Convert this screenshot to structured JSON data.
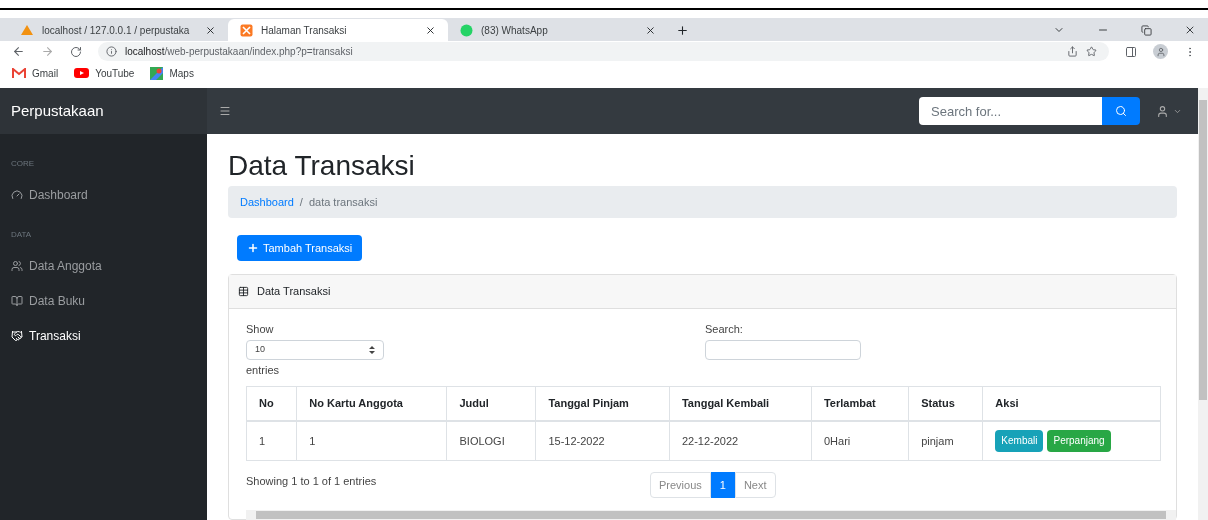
{
  "browser": {
    "tabs": [
      {
        "title": "localhost / 127.0.0.1 / perpustaka",
        "kind": "pma",
        "selected": false
      },
      {
        "title": "Halaman Transaksi",
        "kind": "xampp",
        "selected": true
      },
      {
        "title": "(83) WhatsApp",
        "kind": "whatsapp",
        "selected": false
      }
    ],
    "address": {
      "host": "localhost",
      "path": "/web-perpustakaan/index.php?p=transaksi"
    },
    "bookmarks": [
      {
        "label": "Gmail",
        "kind": "gmail"
      },
      {
        "label": "YouTube",
        "kind": "youtube"
      },
      {
        "label": "Maps",
        "kind": "maps"
      }
    ]
  },
  "navbar": {
    "brand": "Perpustakaan",
    "search": {
      "placeholder": "Search for..."
    }
  },
  "sidebar": {
    "sections": [
      {
        "heading": "CORE",
        "items": [
          {
            "label": "Dashboard",
            "kind": "gauge",
            "selected": false
          }
        ]
      },
      {
        "heading": "DATA",
        "items": [
          {
            "label": "Data Anggota",
            "kind": "users",
            "selected": false
          },
          {
            "label": "Data Buku",
            "kind": "book",
            "selected": false
          },
          {
            "label": "Transaksi",
            "kind": "handshake",
            "selected": true
          }
        ]
      }
    ]
  },
  "page": {
    "title": "Data Transaksi",
    "breadcrumb_separator": "/",
    "breadcrumb": [
      {
        "label": "Dashboard",
        "kind": "link"
      },
      {
        "label": "data transaksi",
        "kind": "current"
      }
    ],
    "add_button": "Tambah Transaksi"
  },
  "card": {
    "title": "Data Transaksi",
    "length": {
      "show_label": "Show",
      "value": "10",
      "entries_label": "entries"
    },
    "search_label": "Search:",
    "table": {
      "columns": [
        "No",
        "No Kartu Anggota",
        "Judul",
        "Tanggal Pinjam",
        "Tanggal Kembali",
        "Terlambat",
        "Status",
        "Aksi"
      ],
      "rows": [
        {
          "cells": [
            "1",
            "1",
            "BIOLOGI",
            "15-12-2022",
            "22-12-2022",
            "0Hari",
            "pinjam"
          ],
          "actions": [
            {
              "label": "Kembali",
              "kind": "info"
            },
            {
              "label": "Perpanjang",
              "kind": "success"
            }
          ]
        }
      ]
    },
    "info": "Showing 1 to 1 of 1 entries",
    "pagination": [
      {
        "label": "Previous",
        "selected": false
      },
      {
        "label": "1",
        "selected": true
      },
      {
        "label": "Next",
        "selected": false
      }
    ]
  }
}
